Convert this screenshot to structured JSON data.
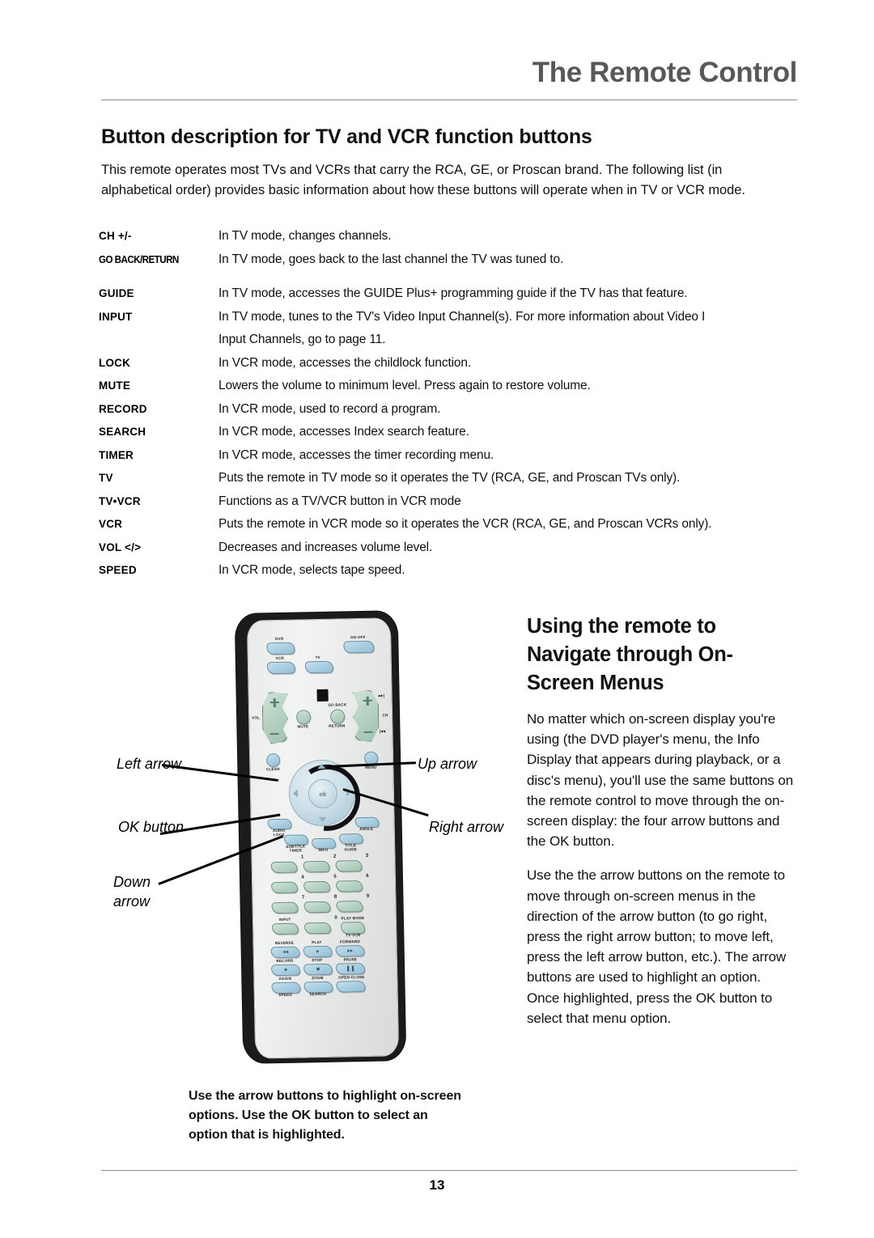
{
  "header": {
    "title": "The Remote Control"
  },
  "section": {
    "title": "Button description for TV and VCR function buttons",
    "intro": "This remote operates most TVs and VCRs that carry the RCA, GE, or Proscan brand. The following list (in alphabetical order) provides basic information about how these buttons will operate when in TV or VCR mode."
  },
  "definitions": [
    {
      "term": "CH +/-",
      "desc": "In TV mode, changes channels.",
      "desc2": ""
    },
    {
      "term": "GO BACK/RETURN",
      "desc": "In TV mode, goes back to the last channel the TV was tuned to.",
      "desc2": ""
    },
    {
      "term": "GUIDE",
      "desc": "In TV mode, accesses the GUIDE Plus+ programming guide if the TV has that feature.",
      "desc2": ""
    },
    {
      "term": "INPUT",
      "desc": "In TV mode, tunes to the TV's Video Input Channel(s). For more information about Video I",
      "desc2": "Input Channels, go to page 11."
    },
    {
      "term": "LOCK",
      "desc": "In VCR mode, accesses the childlock function.",
      "desc2": ""
    },
    {
      "term": "MUTE",
      "desc": "Lowers the volume to minimum level. Press again to restore volume.",
      "desc2": ""
    },
    {
      "term": "RECORD",
      "desc": "In VCR mode, used to record a program.",
      "desc2": ""
    },
    {
      "term": "SEARCH",
      "desc": "In VCR mode, accesses Index search feature.",
      "desc2": ""
    },
    {
      "term": "TIMER",
      "desc": "In VCR mode, accesses the timer recording menu.",
      "desc2": ""
    },
    {
      "term": "TV",
      "desc": "Puts the remote in TV mode so it operates the TV (RCA, GE, and Proscan TVs only).",
      "desc2": ""
    },
    {
      "term": "TV•VCR",
      "desc": "Functions as a TV/VCR button in VCR mode",
      "desc2": ""
    },
    {
      "term": "VCR",
      "desc": "Puts the remote in VCR mode so it operates the VCR (RCA, GE, and Proscan VCRs only).",
      "desc2": ""
    },
    {
      "term": "VOL </>",
      "desc": "Decreases and increases volume level.",
      "desc2": ""
    },
    {
      "term": "SPEED",
      "desc": "In VCR mode, selects tape speed.",
      "desc2": ""
    }
  ],
  "right_column": {
    "title": "Using the remote to Navigate through On-Screen Menus",
    "paragraph1": "No matter which on-screen display you're using (the DVD player's menu, the Info Display that appears during playback, or a disc's menu), you'll use the same buttons on the remote control to move through the on-screen display: the four arrow buttons and the OK button.",
    "paragraph2": "Use the the arrow buttons on the remote to move through on-screen menus in the direction of the arrow button (to go right, press the right arrow button; to move left, press the left arrow button, etc.). The arrow buttons are used to highlight an option. Once highlighted, press the OK button to select that menu option."
  },
  "caption": "Use the arrow buttons to highlight on-screen options. Use the OK button to select an option that is highlighted.",
  "callouts": {
    "left_arrow": "Left arrow",
    "ok_button": "OK button",
    "down_arrow": "Down arrow",
    "up_arrow": "Up arrow",
    "right_arrow": "Right arrow"
  },
  "footer": {
    "page_number": "13"
  },
  "remote": {
    "labels": {
      "dvd": "DVD",
      "on_off": "ON·OFF",
      "vcr": "VCR",
      "tv": "TV",
      "vol": "VOL",
      "ch": "CH",
      "mute": "MUTE",
      "go_back": "GO BACK",
      "return": "RETURN",
      "clear": "CLEAR",
      "menu": "MENU",
      "ok": "ok",
      "audio_lock": "AUDIO\nLOCK",
      "angle": "ANGLE",
      "subtitle_timer": "SUBTITLE\nTIMER",
      "info": "INFO",
      "title_guide": "TITLE\nGUIDE",
      "n1": "1",
      "n2": "2",
      "n3": "3",
      "n4": "4",
      "n5": "5",
      "n6": "6",
      "n7": "7",
      "n8": "8",
      "n9": "9",
      "n0": "0",
      "input": "INPUT",
      "play_mode": "PLAY MODE",
      "tv_vcr": "TV·VCR",
      "reverse": "REVERSE",
      "play": "PLAY",
      "forward": "FORWARD",
      "record": "RECORD",
      "stop": "STOP",
      "pause": "PAUSE",
      "again": "AGAIN",
      "zoom": "ZOOM",
      "open_close": "OPEN·CLOSE",
      "speed": "SPEED",
      "search": "SEARCH"
    }
  },
  "colors": {
    "header_gray": "#58585a",
    "rule_gray": "#8d8d8d",
    "button_blue": "#a7cde0",
    "button_green": "#b4d1c2",
    "remote_body": "#1b1b1b",
    "remote_face": "#e9eaea"
  }
}
